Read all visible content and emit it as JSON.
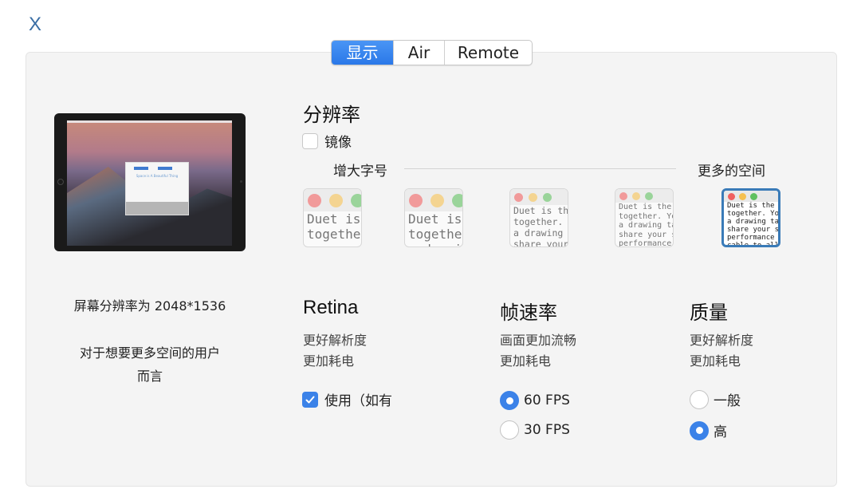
{
  "close_label": "X",
  "tabs": [
    {
      "label": "显示",
      "active": true
    },
    {
      "label": "Air",
      "active": false
    },
    {
      "label": "Remote",
      "active": false
    }
  ],
  "device_preview": {
    "window_title": "Space is A Beautiful Thing"
  },
  "left_info": {
    "resolution": "屏幕分辨率为 2048*1536",
    "description_line1": "对于想要更多空间的用户",
    "description_line2": "而言"
  },
  "resolution_section": {
    "title": "分辨率",
    "mirror_label": "镜像",
    "mirror_checked": false,
    "slider_left_label": "增大字号",
    "slider_right_label": "更多的空间",
    "selected_index": 4,
    "thumbnails": [
      {
        "lines": [
          "Duet is",
          "togethe"
        ]
      },
      {
        "lines": [
          "Duet is",
          "togethe",
          "a drawi"
        ]
      },
      {
        "lines": [
          "Duet is th",
          "together.",
          "a drawing",
          "share your"
        ]
      },
      {
        "lines": [
          "Duet is the",
          "together. Yo",
          "a drawing ta",
          "share your s",
          "performance"
        ]
      },
      {
        "lines": [
          "Duet is the b",
          "together. You",
          "a drawing tab",
          "share your sc",
          "performance s",
          "cable to allo"
        ]
      }
    ]
  },
  "retina": {
    "title": "Retina",
    "desc1": "更好解析度",
    "desc2": "更加耗电",
    "use_label": "使用（如有",
    "use_checked": true
  },
  "framerate": {
    "title": "帧速率",
    "desc1": "画面更加流畅",
    "desc2": "更加耗电",
    "options": [
      {
        "label": "60 FPS",
        "selected": true
      },
      {
        "label": "30 FPS",
        "selected": false
      }
    ]
  },
  "quality": {
    "title": "质量",
    "desc1": "更好解析度",
    "desc2": "更加耗电",
    "options": [
      {
        "label": "一般",
        "selected": false
      },
      {
        "label": "高",
        "selected": true
      }
    ]
  },
  "colors": {
    "accent": "#3b82e8",
    "selected_border": "#3a7bb8",
    "close": "#3a6ea5",
    "panel_bg": "#f4f4f4"
  }
}
